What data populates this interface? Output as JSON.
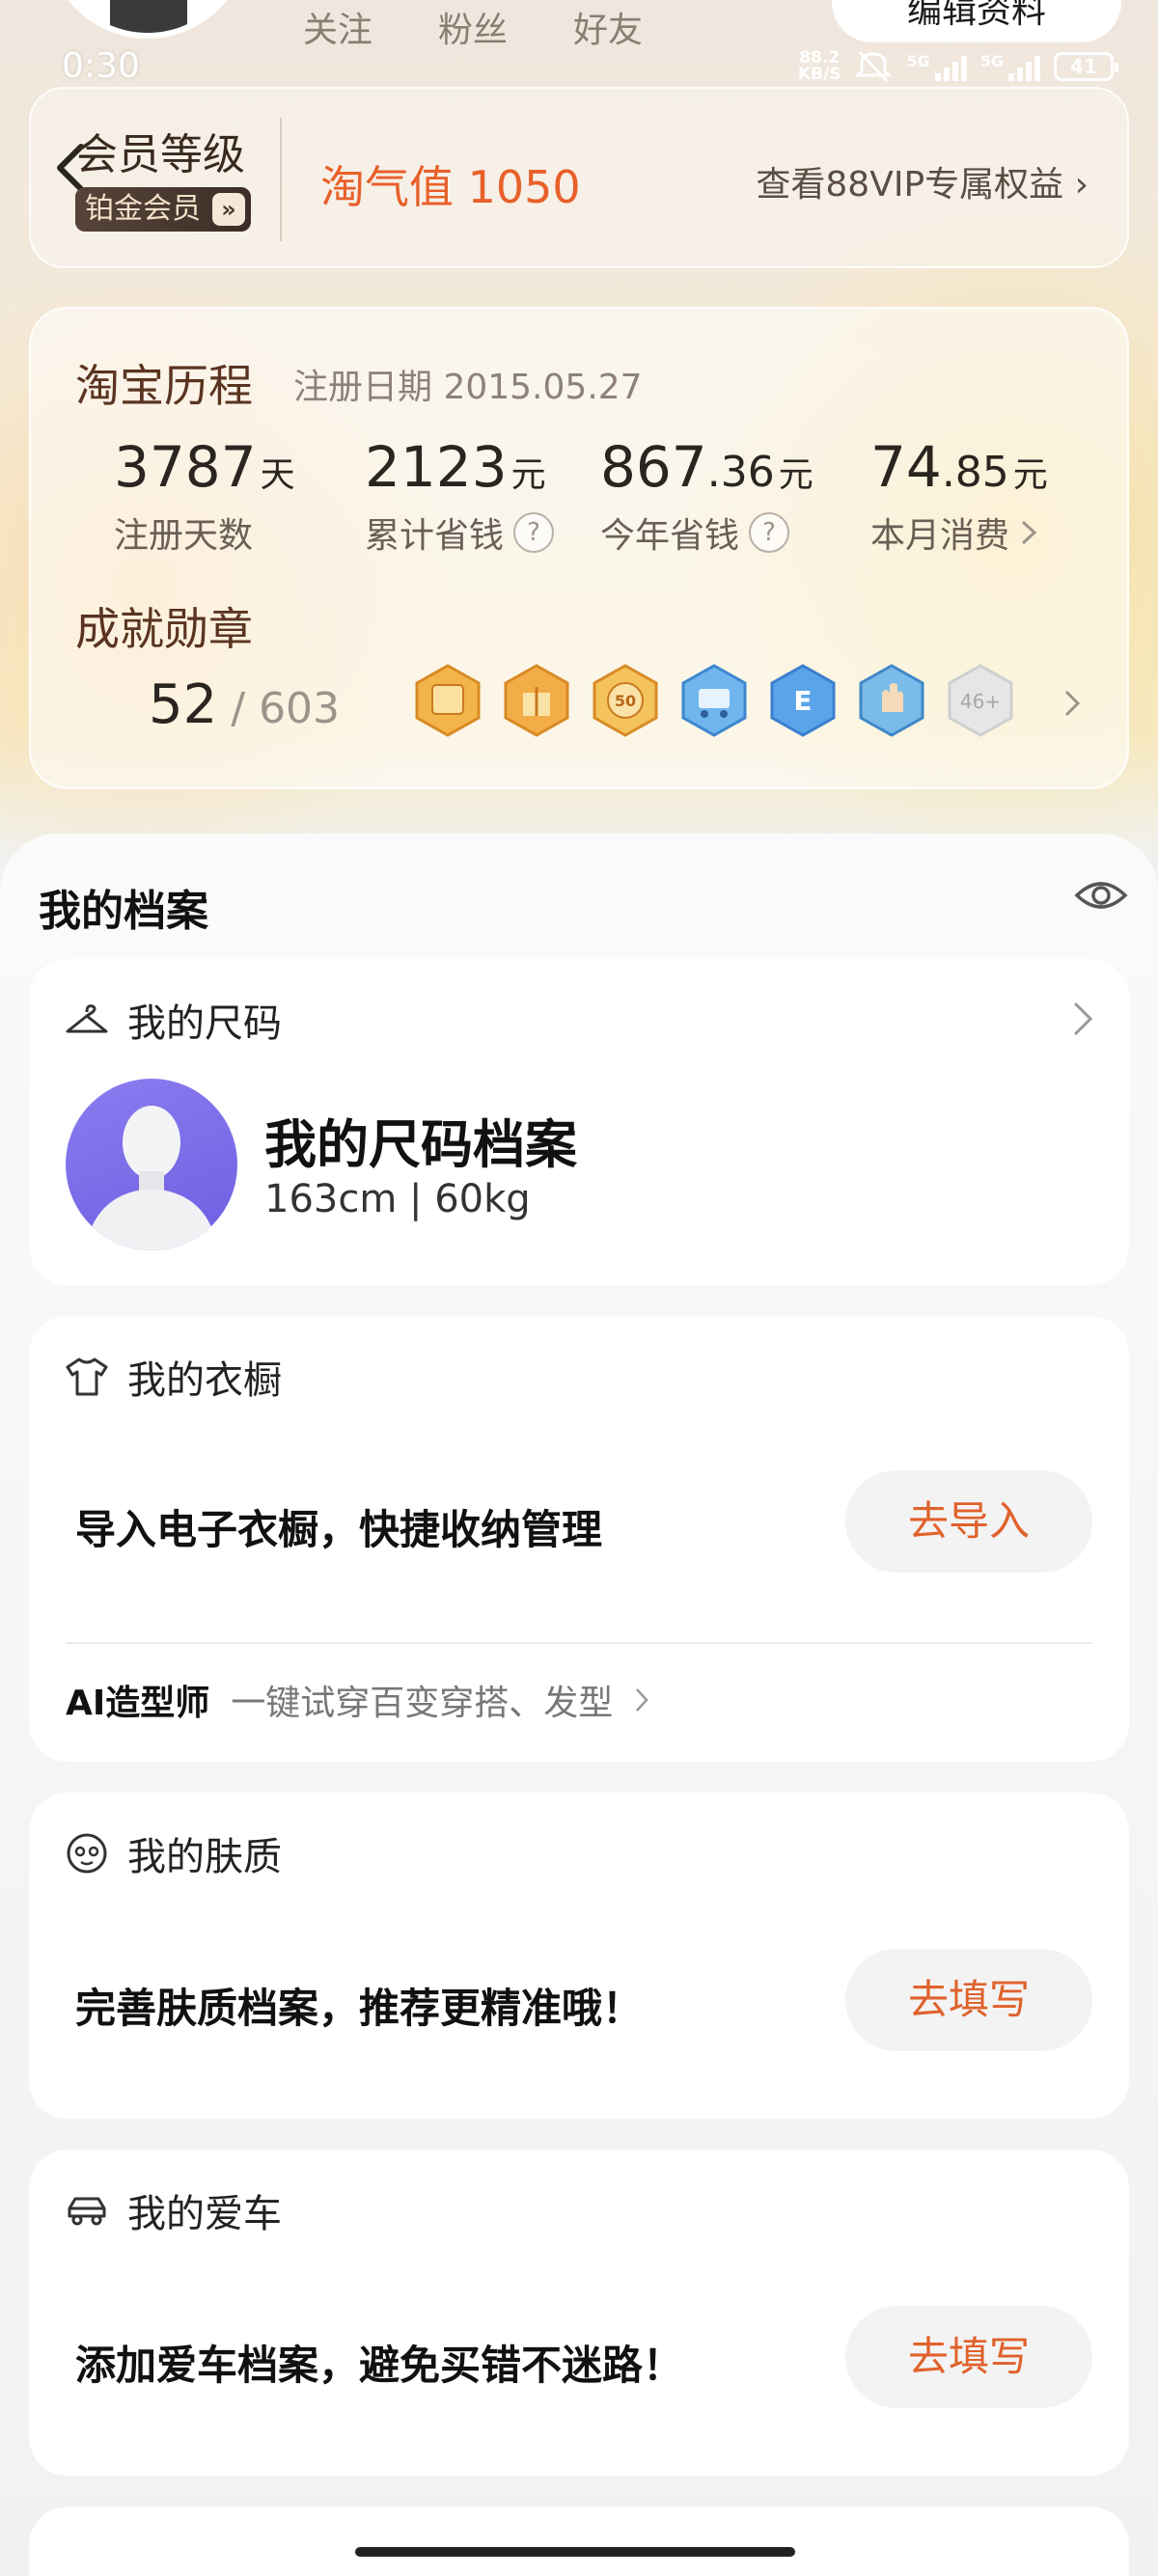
{
  "status_bar": {
    "time": "0:30",
    "net_speed_value": "88.2",
    "net_speed_unit": "KB/S",
    "signal_1": "5G",
    "signal_2": "5G",
    "battery": "41"
  },
  "profile": {
    "stats": [
      "关注",
      "粉丝",
      "好友"
    ],
    "edit_label": "编辑资料"
  },
  "member": {
    "level_title": "会员等级",
    "badge": "铂金会员",
    "badge_arrow": "»",
    "taoqi": "淘气值 1050",
    "vip_link": "查看88VIP专属权益 ›"
  },
  "history": {
    "title": "淘宝历程",
    "reg_date": "注册日期 2015.05.27",
    "stats": [
      {
        "num": "3787",
        "dec": "",
        "unit": "天",
        "label": "注册天数"
      },
      {
        "num": "2123",
        "dec": "",
        "unit": "元",
        "label": "累计省钱"
      },
      {
        "num": "867",
        "dec": ".36",
        "unit": "元",
        "label": "今年省钱"
      },
      {
        "num": "74",
        "dec": ".85",
        "unit": "元",
        "label": "本月消费"
      }
    ],
    "achievements_title": "成就勋章",
    "achievements_count": "52",
    "achievements_total": " / 603",
    "more_badges": "46+"
  },
  "archive": {
    "title": "我的档案",
    "size": {
      "head": "我的尺码",
      "title": "我的尺码档案",
      "sub": "163cm | 60kg"
    },
    "wardrobe": {
      "head": "我的衣橱",
      "prompt": "导入电子衣橱，快捷收纳管理",
      "button": "去导入",
      "ai_label": "AI造型师",
      "ai_desc": "一键试穿百变穿搭、发型"
    },
    "skin": {
      "head": "我的肤质",
      "prompt": "完善肤质档案，推荐更精准哦！",
      "button": "去填写"
    },
    "car": {
      "head": "我的爱车",
      "prompt": "添加爱车档案，避免买错不迷路！",
      "button": "去填写"
    }
  },
  "colors": {
    "accent_orange": "#e0622c",
    "taoqi_orange": "#e8602a",
    "badge_dark": "#3c2e27"
  }
}
